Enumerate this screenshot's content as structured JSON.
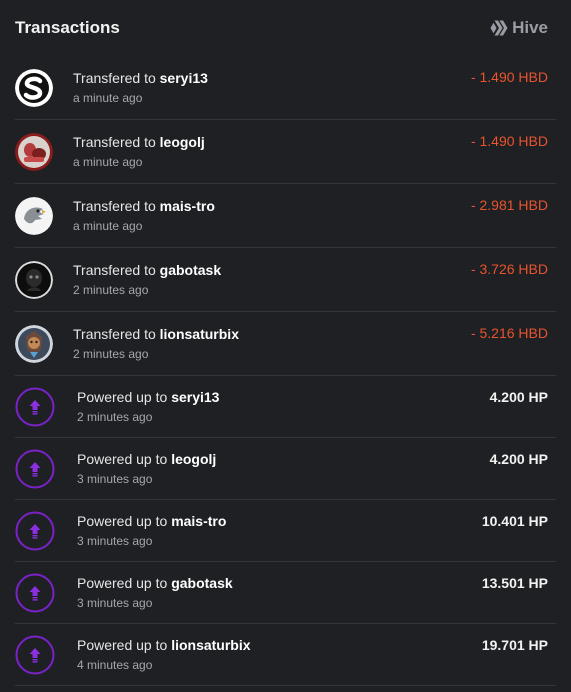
{
  "header": {
    "title": "Transactions",
    "brand_label": "Hive",
    "brand_icon": "hive-logo-icon"
  },
  "colors": {
    "background": "#1e2024",
    "negative_amount": "#e8542b",
    "power_up_ring": "#7a22c8",
    "divider": "#33363b"
  },
  "transactions": [
    {
      "kind": "transfer",
      "verb": "Transfered to",
      "account": "seryi13",
      "time": "a minute ago",
      "amount": "- 1.490 HBD",
      "avatar": "seryi13-avatar"
    },
    {
      "kind": "transfer",
      "verb": "Transfered to",
      "account": "leogolj",
      "time": "a minute ago",
      "amount": "- 1.490 HBD",
      "avatar": "leogolj-avatar"
    },
    {
      "kind": "transfer",
      "verb": "Transfered to",
      "account": "mais-tro",
      "time": "a minute ago",
      "amount": "- 2.981 HBD",
      "avatar": "mais-tro-avatar"
    },
    {
      "kind": "transfer",
      "verb": "Transfered to",
      "account": "gabotask",
      "time": "2 minutes ago",
      "amount": "- 3.726 HBD",
      "avatar": "gabotask-avatar"
    },
    {
      "kind": "transfer",
      "verb": "Transfered to",
      "account": "lionsaturbix",
      "time": "2 minutes ago",
      "amount": "- 5.216 HBD",
      "avatar": "lionsaturbix-avatar"
    },
    {
      "kind": "power_up",
      "verb": "Powered up to",
      "account": "seryi13",
      "time": "2 minutes ago",
      "amount": "4.200 HP",
      "avatar": "power-up-icon"
    },
    {
      "kind": "power_up",
      "verb": "Powered up to",
      "account": "leogolj",
      "time": "3 minutes ago",
      "amount": "4.200 HP",
      "avatar": "power-up-icon"
    },
    {
      "kind": "power_up",
      "verb": "Powered up to",
      "account": "mais-tro",
      "time": "3 minutes ago",
      "amount": "10.401 HP",
      "avatar": "power-up-icon"
    },
    {
      "kind": "power_up",
      "verb": "Powered up to",
      "account": "gabotask",
      "time": "3 minutes ago",
      "amount": "13.501 HP",
      "avatar": "power-up-icon"
    },
    {
      "kind": "power_up",
      "verb": "Powered up to",
      "account": "lionsaturbix",
      "time": "4 minutes ago",
      "amount": "19.701 HP",
      "avatar": "power-up-icon"
    }
  ]
}
